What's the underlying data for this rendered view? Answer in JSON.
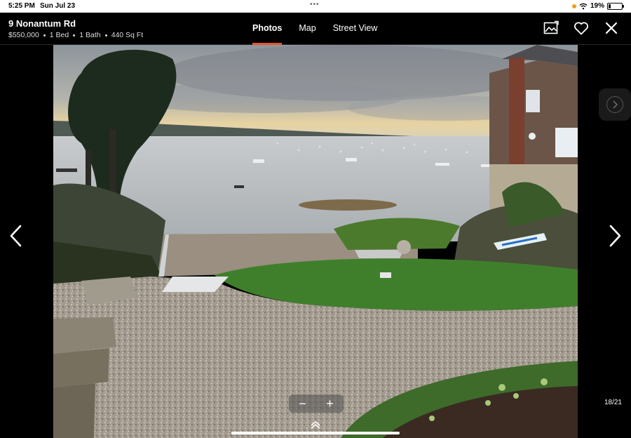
{
  "status_bar": {
    "time": "5:25 PM",
    "date": "Sun Jul 23",
    "battery": "19%",
    "battery_level": 0.19
  },
  "listing": {
    "address": "9 Nonantum Rd",
    "price": "$550,000",
    "beds": "1 Bed",
    "baths": "1 Bath",
    "sqft": "440 Sq Ft"
  },
  "tabs": [
    {
      "label": "Photos",
      "active": true
    },
    {
      "label": "Map",
      "active": false
    },
    {
      "label": "Street View",
      "active": false
    }
  ],
  "header_icons": [
    "photo-gallery-icon",
    "heart-icon",
    "close-icon"
  ],
  "photo": {
    "counter": "18/21",
    "description_icon": "harbor-photo"
  },
  "zoom": {
    "minus": "−",
    "plus": "+"
  },
  "colors": {
    "accent": "#e8552b",
    "background": "#000000"
  }
}
